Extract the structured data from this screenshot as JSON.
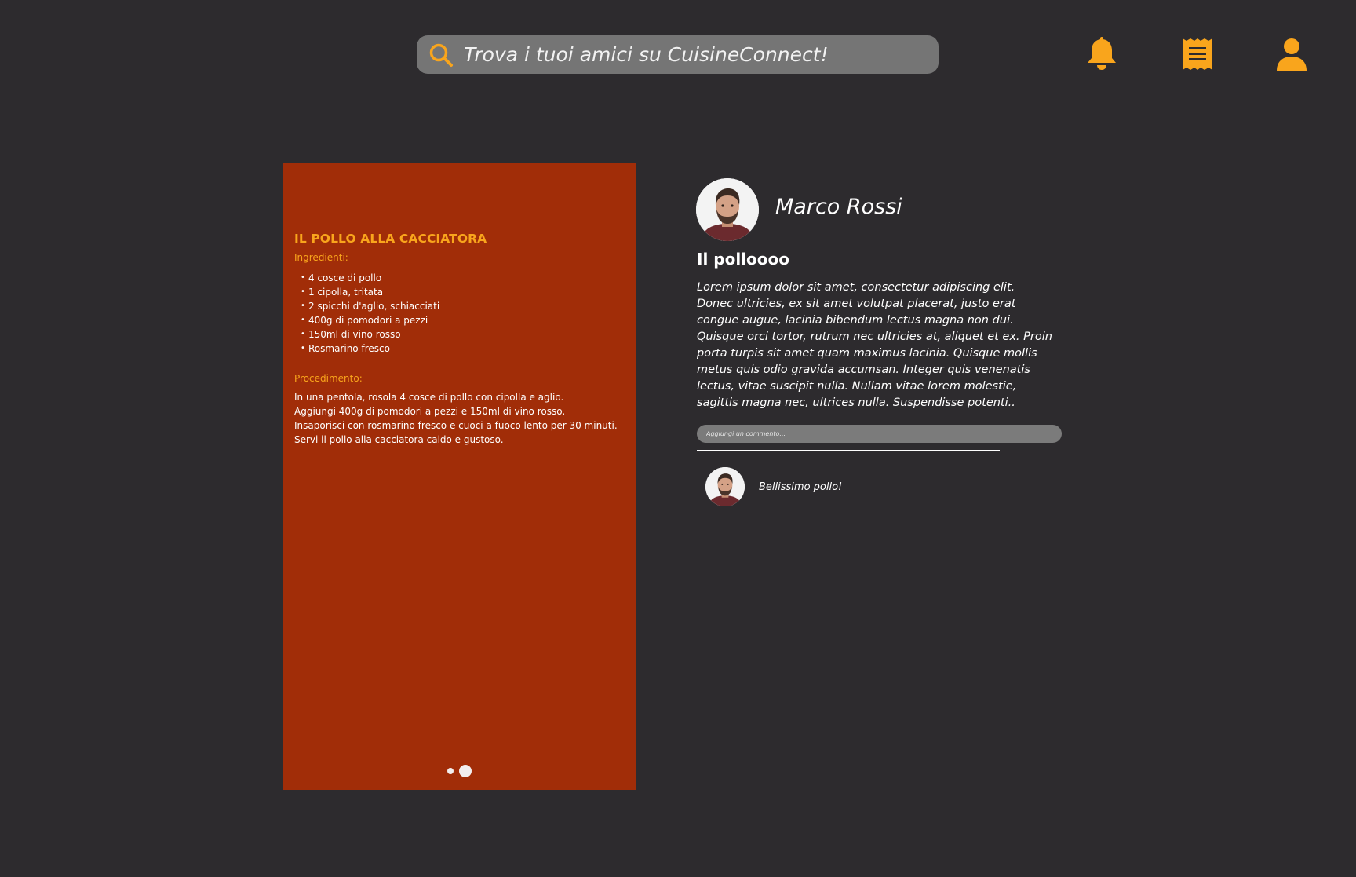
{
  "search": {
    "placeholder": "Trova i tuoi amici su CuisineConnect!"
  },
  "icons": {
    "accent_color": "#f9a51c",
    "top_bar": [
      "search-icon",
      "bell-icon",
      "receipt-icon",
      "profile-icon"
    ]
  },
  "recipe": {
    "title": "IL POLLO ALLA CACCIATORA",
    "ingredients_label": "Ingredienti:",
    "ingredients": [
      "4 cosce di pollo",
      "1 cipolla, tritata",
      "2 spicchi d'aglio, schiacciati",
      "400g di pomodori a pezzi",
      "150ml di vino rosso",
      "Rosmarino fresco"
    ],
    "procedure_label": "Procedimento:",
    "procedure": [
      "In una pentola, rosola 4 cosce di pollo con cipolla e aglio.",
      "Aggiungi 400g di pomodori a pezzi e 150ml di vino rosso.",
      "Insaporisci con rosmarino fresco e cuoci a fuoco lento per 30 minuti.",
      "Servi il pollo alla cacciatora caldo e gustoso."
    ],
    "card_color": "#a12d08",
    "slides_total": 2,
    "active_slide": 2
  },
  "post": {
    "author_name": "Marco Rossi",
    "title": "Il polloooo",
    "body": "Lorem ipsum dolor sit amet, consectetur adipiscing elit. Donec ultricies, ex sit amet volutpat placerat, justo erat congue augue, lacinia bibendum lectus magna non dui. Quisque orci tortor, rutrum nec ultricies at, aliquet et ex. Proin porta turpis sit amet quam maximus lacinia. Quisque mollis metus quis odio gravida accumsan. Integer quis venenatis lectus, vitae suscipit nulla. Nullam vitae lorem molestie, sagittis magna nec, ultrices nulla. Suspendisse potenti..",
    "comment_placeholder": "Aggiungi un commento..."
  },
  "comments": [
    {
      "text": "Bellissimo pollo!"
    }
  ]
}
